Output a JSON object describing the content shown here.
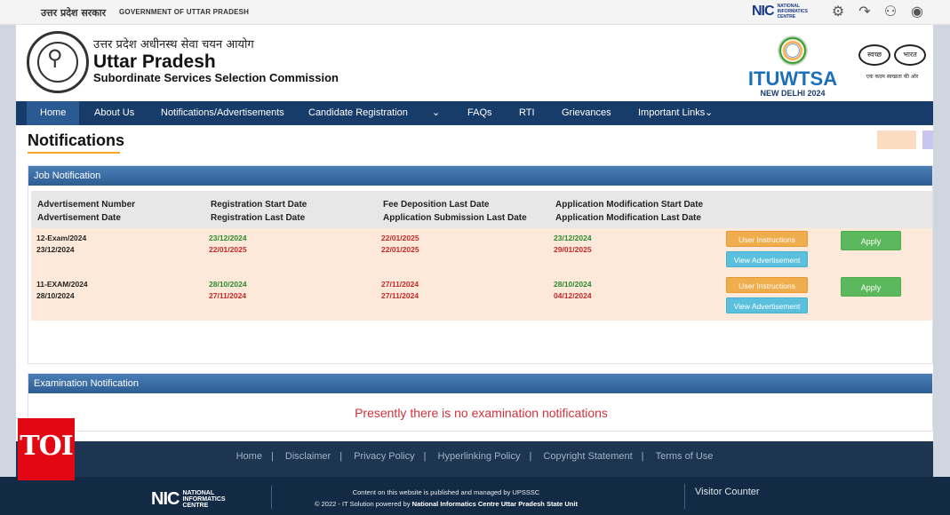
{
  "topbar": {
    "hindi_label": "उत्तर प्रदेश सरकार",
    "gov_label": "GOVERNMENT OF UTTAR PRADESH",
    "nic_word": "NIC",
    "nic_caption": "NATIONAL INFORMATICS CENTRE",
    "icons": [
      "gear-icon",
      "share-icon",
      "add-user-icon",
      "accessibility-icon"
    ]
  },
  "header": {
    "hindi_title": "उत्तर प्रदेश अधीनस्थ सेवा चयन आयोग",
    "title": "Uttar Pradesh",
    "subtitle": "Subordinate Services Selection Commission",
    "itu_word": "ITUWTSA",
    "itu_city": "NEW DELHI 2024",
    "swachh_left": "स्वच्छ",
    "swachh_right": "भारत",
    "swachh_tag": "एक कदम स्वच्छता की ओर"
  },
  "nav": {
    "items": [
      "Home",
      "About Us",
      "Notifications/Advertisements",
      "Candidate Registration",
      "FAQs",
      "RTI",
      "Grievances",
      "Important Links"
    ],
    "chevron": "⌄"
  },
  "page": {
    "title": "Notifications"
  },
  "job_panel": {
    "heading": "Job Notification",
    "headers": [
      {
        "line1": "Advertisement Number",
        "line2": "Advertisement Date"
      },
      {
        "line1": "Registration Start Date",
        "line2": "Registration Last Date"
      },
      {
        "line1": "Fee Deposition Last Date",
        "line2": "Application Submission Last Date"
      },
      {
        "line1": "Application Modification Start Date",
        "line2": "Application Modification Last Date"
      }
    ],
    "rows": [
      {
        "adv_no": "12-Exam/2024",
        "adv_date": "23/12/2024",
        "reg_start": "23/12/2024",
        "reg_last": "22/01/2025",
        "fee_last": "22/01/2025",
        "sub_last": "22/01/2025",
        "mod_start": "23/12/2024",
        "mod_last": "29/01/2025"
      },
      {
        "adv_no": "11-EXAM/2024",
        "adv_date": "28/10/2024",
        "reg_start": "28/10/2024",
        "reg_last": "27/11/2024",
        "fee_last": "27/11/2024",
        "sub_last": "27/11/2024",
        "mod_start": "28/10/2024",
        "mod_last": "04/12/2024"
      }
    ],
    "btn_instructions": "User Instructions",
    "btn_view": "View Advertisement",
    "btn_apply": "Apply"
  },
  "exam_panel": {
    "heading": "Examination Notification",
    "message": "Presently there is no examination notifications"
  },
  "footer": {
    "links": [
      "Home",
      "Disclaimer",
      "Privacy Policy",
      "Hyperlinking Policy",
      "Copyright Statement",
      "Terms of Use"
    ],
    "separator": "|",
    "nic_word": "NIC",
    "nic_caption": "NATIONAL INFORMATICS CENTRE",
    "content_line": "Content on this website is published and managed by UPSSSC",
    "credit_prefix": "© 2022 - IT Solution powered by",
    "credit_org": "National Informatics Centre Uttar Pradesh State Unit",
    "visitor_counter": "Visitor Counter"
  },
  "watermark": {
    "text": "TOI"
  },
  "colors": {
    "nav": "#183c6a",
    "accent_orange": "#f0ad4e",
    "accent_blue": "#5bc0de",
    "accent_green": "#5cb85c",
    "row_bg": "#fde9d9",
    "message_red": "#d0323a"
  }
}
